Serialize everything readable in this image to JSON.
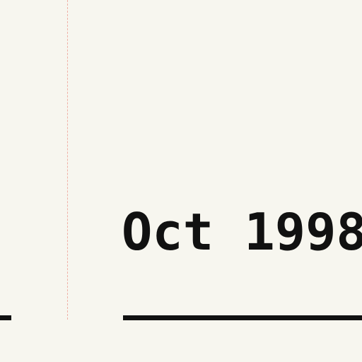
{
  "timeline": {
    "date_label": "Oct 1998"
  },
  "colors": {
    "background": "#f7f6ef",
    "text": "#111111",
    "guide_line": "#f0a99f"
  }
}
